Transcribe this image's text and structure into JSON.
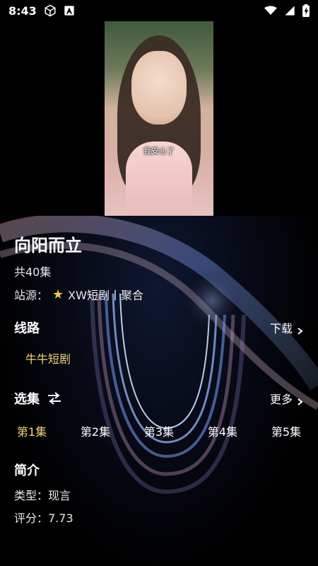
{
  "status_bar": {
    "time": "8:43",
    "icons_left": [
      "cube-icon",
      "notification-a-icon"
    ],
    "icons_right": [
      "wifi-icon",
      "signal-icon",
      "battery-charging-icon"
    ]
  },
  "video": {
    "subtitle": "我安心了"
  },
  "show": {
    "title": "向阳而立",
    "episodes_count": "共40集",
    "source_label": "站源：",
    "source_value": "XW短剧丨聚合"
  },
  "route": {
    "section_title": "线路",
    "download_label": "下载",
    "route_name": "牛牛短剧"
  },
  "episodes": {
    "section_title": "选集",
    "more_label": "更多",
    "items": [
      "第1集",
      "第2集",
      "第3集",
      "第4集",
      "第5集"
    ],
    "active_index": 0
  },
  "brief": {
    "section_title": "简介",
    "type_label": "类型：现言",
    "rating_label": "评分：7.73"
  },
  "colors": {
    "accent": "#f0d37a",
    "background": "#000000"
  }
}
